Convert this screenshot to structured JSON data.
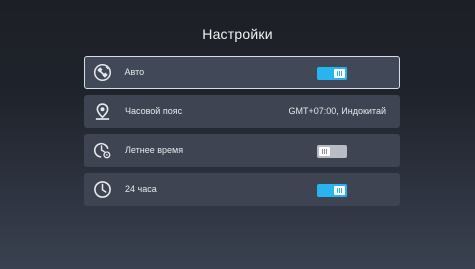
{
  "screen": {
    "title": "Настройки"
  },
  "settings": {
    "items": [
      {
        "label": "Авто",
        "icon": "satellite-icon",
        "control": "toggle",
        "state": "on",
        "focused": true
      },
      {
        "label": "Часовой пояс",
        "icon": "location-pin-icon",
        "control": "value",
        "value": "GMT+07:00, Индокитай"
      },
      {
        "label": "Летнее время",
        "icon": "clock-gear-icon",
        "control": "toggle",
        "state": "off"
      },
      {
        "label": "24 часа",
        "icon": "clock-icon",
        "control": "toggle",
        "state": "on"
      }
    ]
  },
  "colors": {
    "toggle_on": "#27b4ef",
    "toggle_off": "#b7bcc5",
    "row_background": "#3e4452",
    "focus_border": "#d9dce2"
  }
}
